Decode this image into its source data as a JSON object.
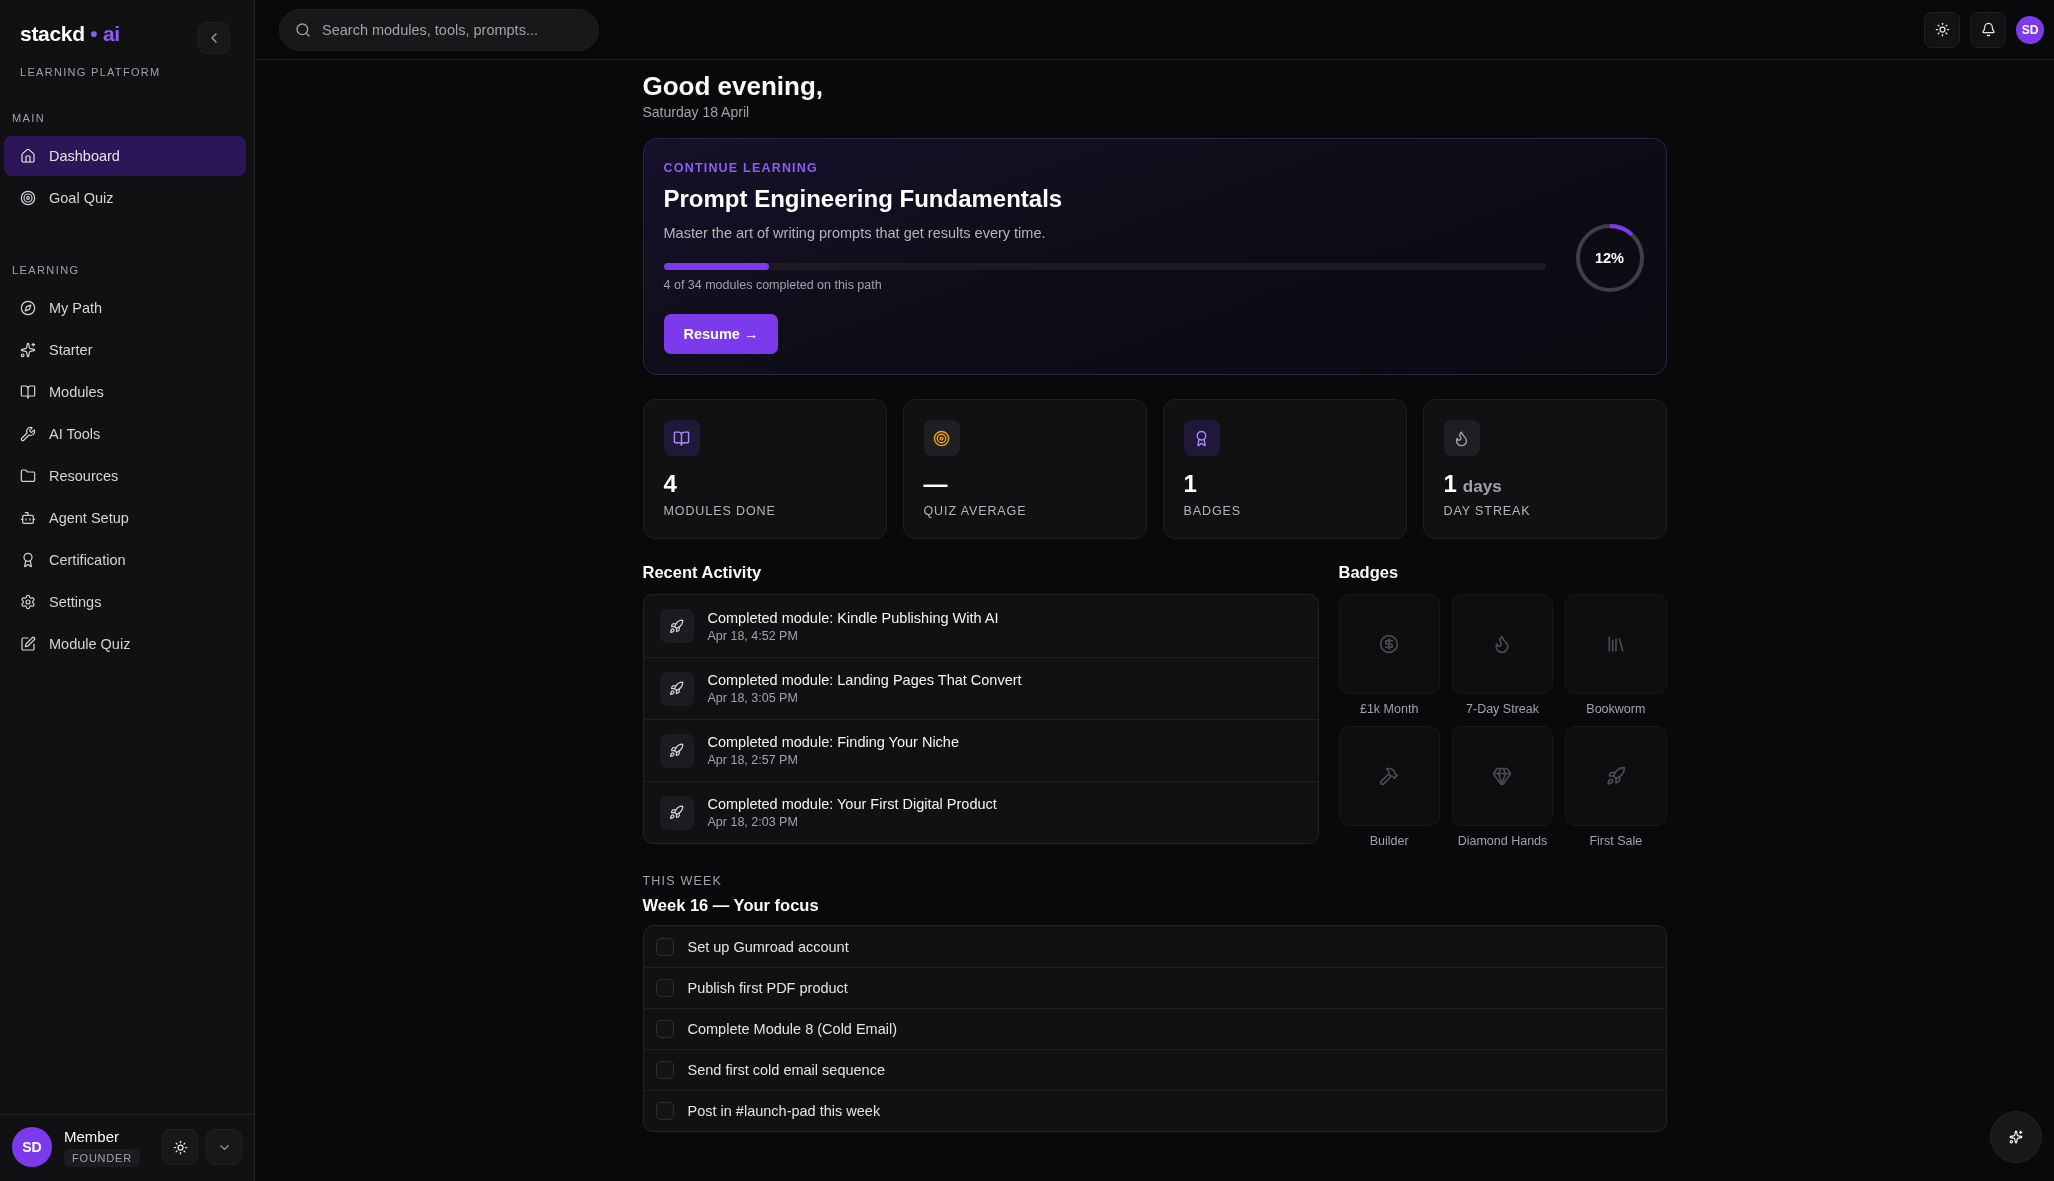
{
  "brand": {
    "name": "stackd",
    "dot": "•",
    "accent": "ai",
    "subtitle": "LEARNING PLATFORM"
  },
  "sidebar": {
    "sections": [
      {
        "title": "MAIN",
        "items": [
          {
            "label": "Dashboard",
            "selected": true
          },
          {
            "label": "Goal Quiz",
            "selected": false
          }
        ]
      },
      {
        "title": "LEARNING",
        "items": [
          {
            "label": "My Path",
            "selected": false
          },
          {
            "label": "Starter",
            "selected": false
          },
          {
            "label": "Modules",
            "selected": false
          },
          {
            "label": "AI Tools",
            "selected": false
          },
          {
            "label": "Resources",
            "selected": false
          },
          {
            "label": "Agent Setup",
            "selected": false
          },
          {
            "label": "Certification",
            "selected": false
          },
          {
            "label": "Settings",
            "selected": false
          },
          {
            "label": "Module Quiz",
            "selected": false
          }
        ]
      }
    ],
    "user": {
      "initials": "SD",
      "name": "Member",
      "role": "FOUNDER"
    }
  },
  "header": {
    "search": {
      "placeholder": "Search modules, tools, prompts..."
    },
    "avatar": "SD"
  },
  "greeting": {
    "title": "Good evening,",
    "date": "Saturday 18 April"
  },
  "continue": {
    "eyebrow": "CONTINUE LEARNING",
    "title": "Prompt Engineering Fundamentals",
    "description": "Master the art of writing prompts that get results every time.",
    "level": 0.12,
    "caption": "4 of 34 modules completed on this path",
    "percent": "12%",
    "button": "Resume →"
  },
  "stats": [
    {
      "value": "4",
      "label": "MODULES DONE"
    },
    {
      "value": "—",
      "label": "QUIZ AVERAGE"
    },
    {
      "value": "1",
      "label": "BADGES"
    },
    {
      "value": "1",
      "unit": "days",
      "label": "DAY STREAK"
    }
  ],
  "recent_activity": {
    "title": "Recent Activity",
    "items": [
      {
        "text": "Completed module: Kindle Publishing With AI",
        "time": "Apr 18, 4:52 PM"
      },
      {
        "text": "Completed module: Landing Pages That Convert",
        "time": "Apr 18, 3:05 PM"
      },
      {
        "text": "Completed module: Finding Your Niche",
        "time": "Apr 18, 2:57 PM"
      },
      {
        "text": "Completed module: Your First Digital Product",
        "time": "Apr 18, 2:03 PM"
      }
    ]
  },
  "badges": {
    "title": "Badges",
    "items": [
      {
        "label": "£1k Month",
        "earned": false
      },
      {
        "label": "7-Day Streak",
        "earned": false
      },
      {
        "label": "Bookworm",
        "earned": false
      },
      {
        "label": "Builder",
        "earned": false
      },
      {
        "label": "Diamond Hands",
        "earned": false
      },
      {
        "label": "First Sale",
        "earned": false
      }
    ]
  },
  "this_week": {
    "eyebrow": "THIS WEEK",
    "title": "Week 16 — Your focus",
    "tasks": [
      {
        "label": "Set up Gumroad account",
        "checked": false
      },
      {
        "label": "Publish first PDF product",
        "checked": false
      },
      {
        "label": "Complete Module 8 (Cold Email)",
        "checked": false
      },
      {
        "label": "Send first cold email sequence",
        "checked": false
      },
      {
        "label": "Post in #launch-pad this week",
        "checked": false
      }
    ]
  }
}
